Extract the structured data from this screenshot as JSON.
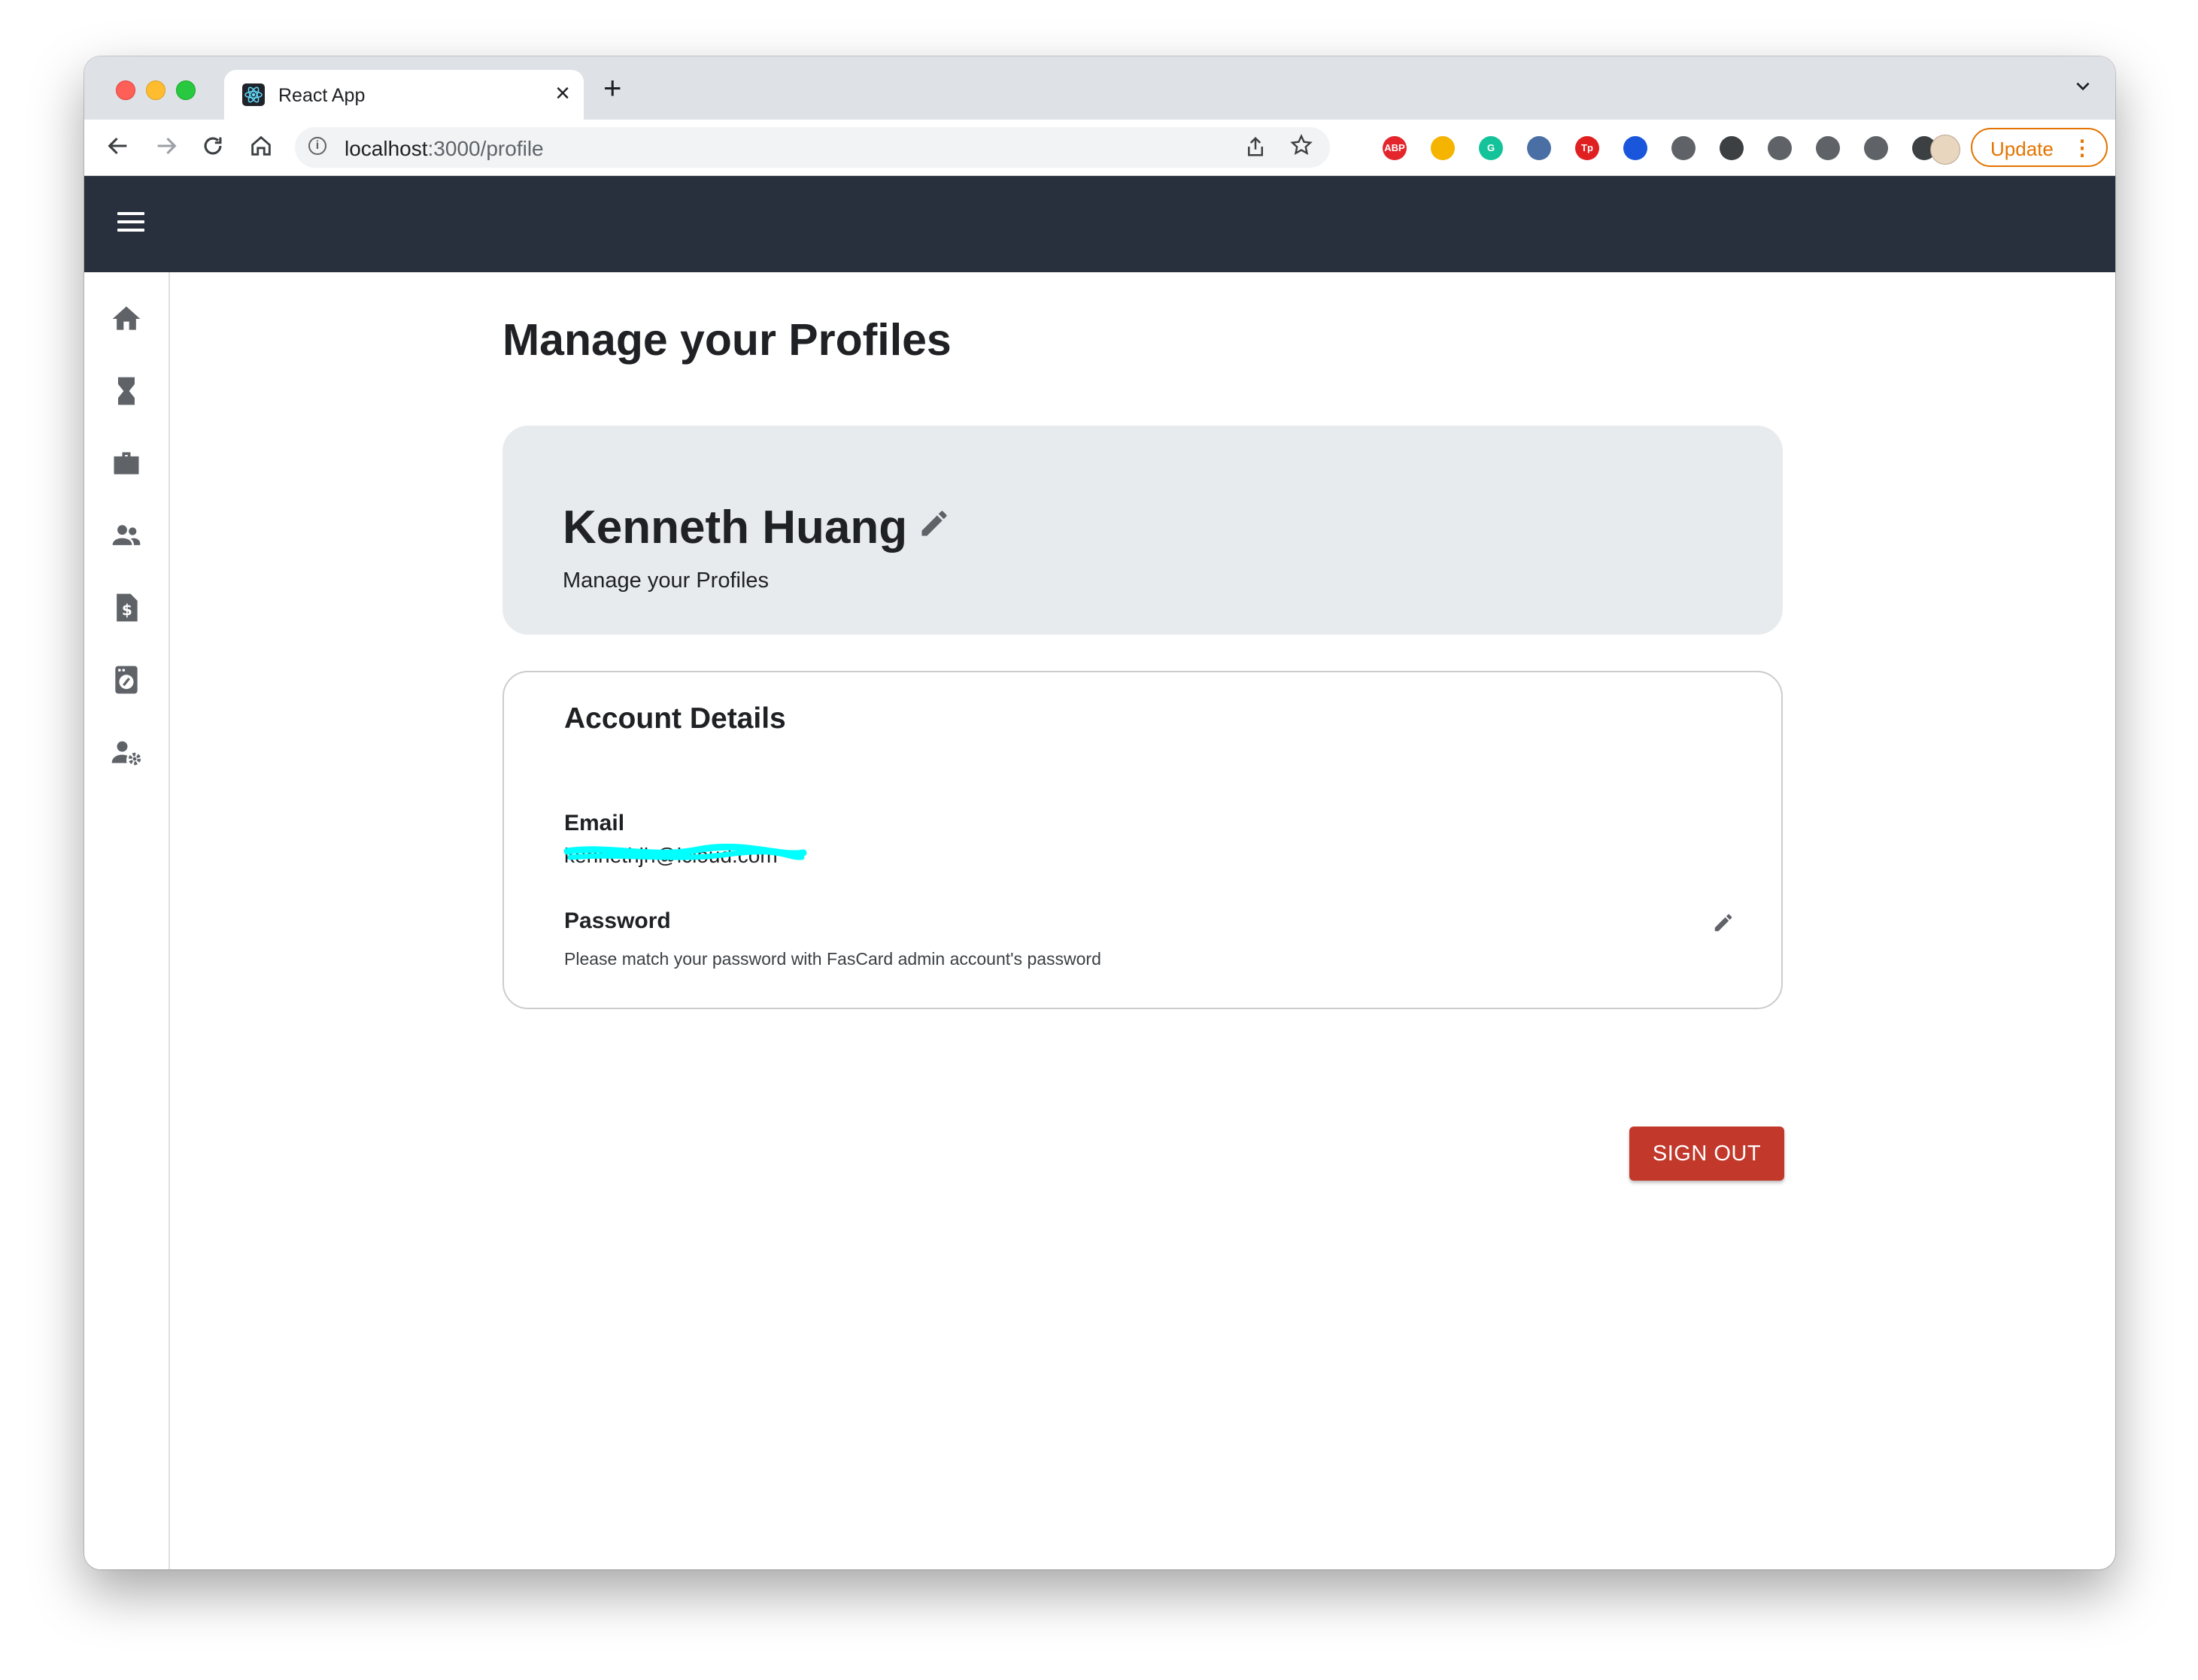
{
  "browser": {
    "tab_title": "React App",
    "tab_close": "×",
    "new_tab": "+",
    "url_host": "localhost",
    "url_path": ":3000/profile",
    "update_label": "Update",
    "extensions": [
      {
        "name": "adblock-plus",
        "label": "ABP",
        "color": "#e4252c"
      },
      {
        "name": "color-wheel",
        "label": "",
        "color": "#f4b400"
      },
      {
        "name": "grammarly",
        "label": "G",
        "color": "#15c39a"
      },
      {
        "name": "stack",
        "label": "",
        "color": "#4a6fa5"
      },
      {
        "name": "tp",
        "label": "Tp",
        "color": "#e02020"
      },
      {
        "name": "droplet",
        "label": "",
        "color": "#1a56db"
      },
      {
        "name": "shield",
        "label": "",
        "color": "#5f6368"
      },
      {
        "name": "bowtie",
        "label": "",
        "color": "#3c4043"
      },
      {
        "name": "eyedropper",
        "label": "",
        "color": "#5f6368"
      },
      {
        "name": "puzzle",
        "label": "",
        "color": "#5f6368"
      },
      {
        "name": "media-queue",
        "label": "",
        "color": "#5f6368"
      },
      {
        "name": "side-panel",
        "label": "",
        "color": "#3c4043"
      }
    ]
  },
  "app": {
    "sidebar_icons": [
      "home-icon",
      "hourglass-icon",
      "briefcase-icon",
      "people-icon",
      "invoice-icon",
      "washer-icon",
      "user-settings-icon"
    ]
  },
  "page": {
    "title": "Manage your Profiles",
    "profile": {
      "name": "Kenneth Huang",
      "subtitle": "Manage your Profiles"
    },
    "account": {
      "title": "Account Details",
      "email_label": "Email",
      "email_value": "kennethjh@icloud.com",
      "password_label": "Password",
      "password_hint": "Please match your password with FasCard admin account's password"
    },
    "signout_label": "SIGN OUT"
  },
  "colors": {
    "appbar": "#28303e",
    "signout": "#c2382b",
    "profile_card": "#e8ebed",
    "update_accent": "#e37400"
  }
}
